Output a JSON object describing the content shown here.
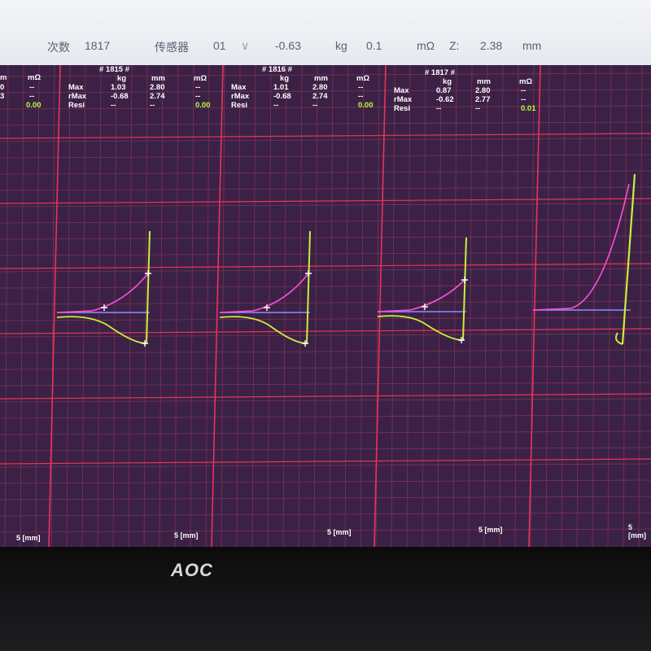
{
  "toolbar": {
    "field1_label": "次数",
    "count": "1817",
    "field2_label": "传感器",
    "sensor": "01",
    "dropdown": "∨",
    "force": "-0.63",
    "unit_kg": "kg",
    "value2": "0.1",
    "unit_mohm": "mΩ",
    "z_label": "Z:",
    "z_value": "2.38",
    "unit_mm": "mm"
  },
  "panels": [
    {
      "title": "",
      "rows": [
        {
          "label": "",
          "kg": "",
          "mm": "0",
          "mohm": "--"
        },
        {
          "label": "",
          "kg": "",
          "mm": "3",
          "mohm": "--"
        },
        {
          "label": "",
          "kg": "",
          "mm": "",
          "mohm": "0.00"
        }
      ],
      "units": {
        "kg": "",
        "mm": "m",
        "mohm": "mΩ"
      }
    },
    {
      "title": "# 1815 #",
      "units": {
        "kg": "kg",
        "mm": "mm",
        "mohm": "mΩ"
      },
      "rows": [
        {
          "label": "Max",
          "kg": "1.03",
          "mm": "2.80",
          "mohm": "--"
        },
        {
          "label": "rMax",
          "kg": "-0.68",
          "mm": "2.74",
          "mohm": "--"
        },
        {
          "label": "Resi",
          "kg": "--",
          "mm": "--",
          "mohm": "0.00"
        }
      ]
    },
    {
      "title": "# 1816 #",
      "units": {
        "kg": "kg",
        "mm": "mm",
        "mohm": "mΩ"
      },
      "rows": [
        {
          "label": "Max",
          "kg": "1.01",
          "mm": "2.80",
          "mohm": "--"
        },
        {
          "label": "rMax",
          "kg": "-0.68",
          "mm": "2.74",
          "mohm": "--"
        },
        {
          "label": "Resi",
          "kg": "--",
          "mm": "--",
          "mohm": "0.00"
        }
      ]
    },
    {
      "title": "# 1817 #",
      "units": {
        "kg": "kg",
        "mm": "mm",
        "mohm": "mΩ"
      },
      "rows": [
        {
          "label": "Max",
          "kg": "0.87",
          "mm": "2.80",
          "mohm": "--"
        },
        {
          "label": "rMax",
          "kg": "-0.62",
          "mm": "2.77",
          "mohm": "--"
        },
        {
          "label": "Resi",
          "kg": "--",
          "mm": "--",
          "mohm": "0.01"
        }
      ]
    }
  ],
  "axis_labels": [
    "5 [mm]",
    "5 [mm]",
    "5 [mm]",
    "5 [mm]",
    "5 [mm]"
  ],
  "brand": "AOC",
  "colors": {
    "background": "#3c2146",
    "grid_major": "#e8335a",
    "grid_minor": "#7a3355",
    "push_curve": "#ff4fd8",
    "return_curve": "#c8f03a",
    "baseline": "#8f8cff",
    "value_green": "#b9ff3a"
  }
}
